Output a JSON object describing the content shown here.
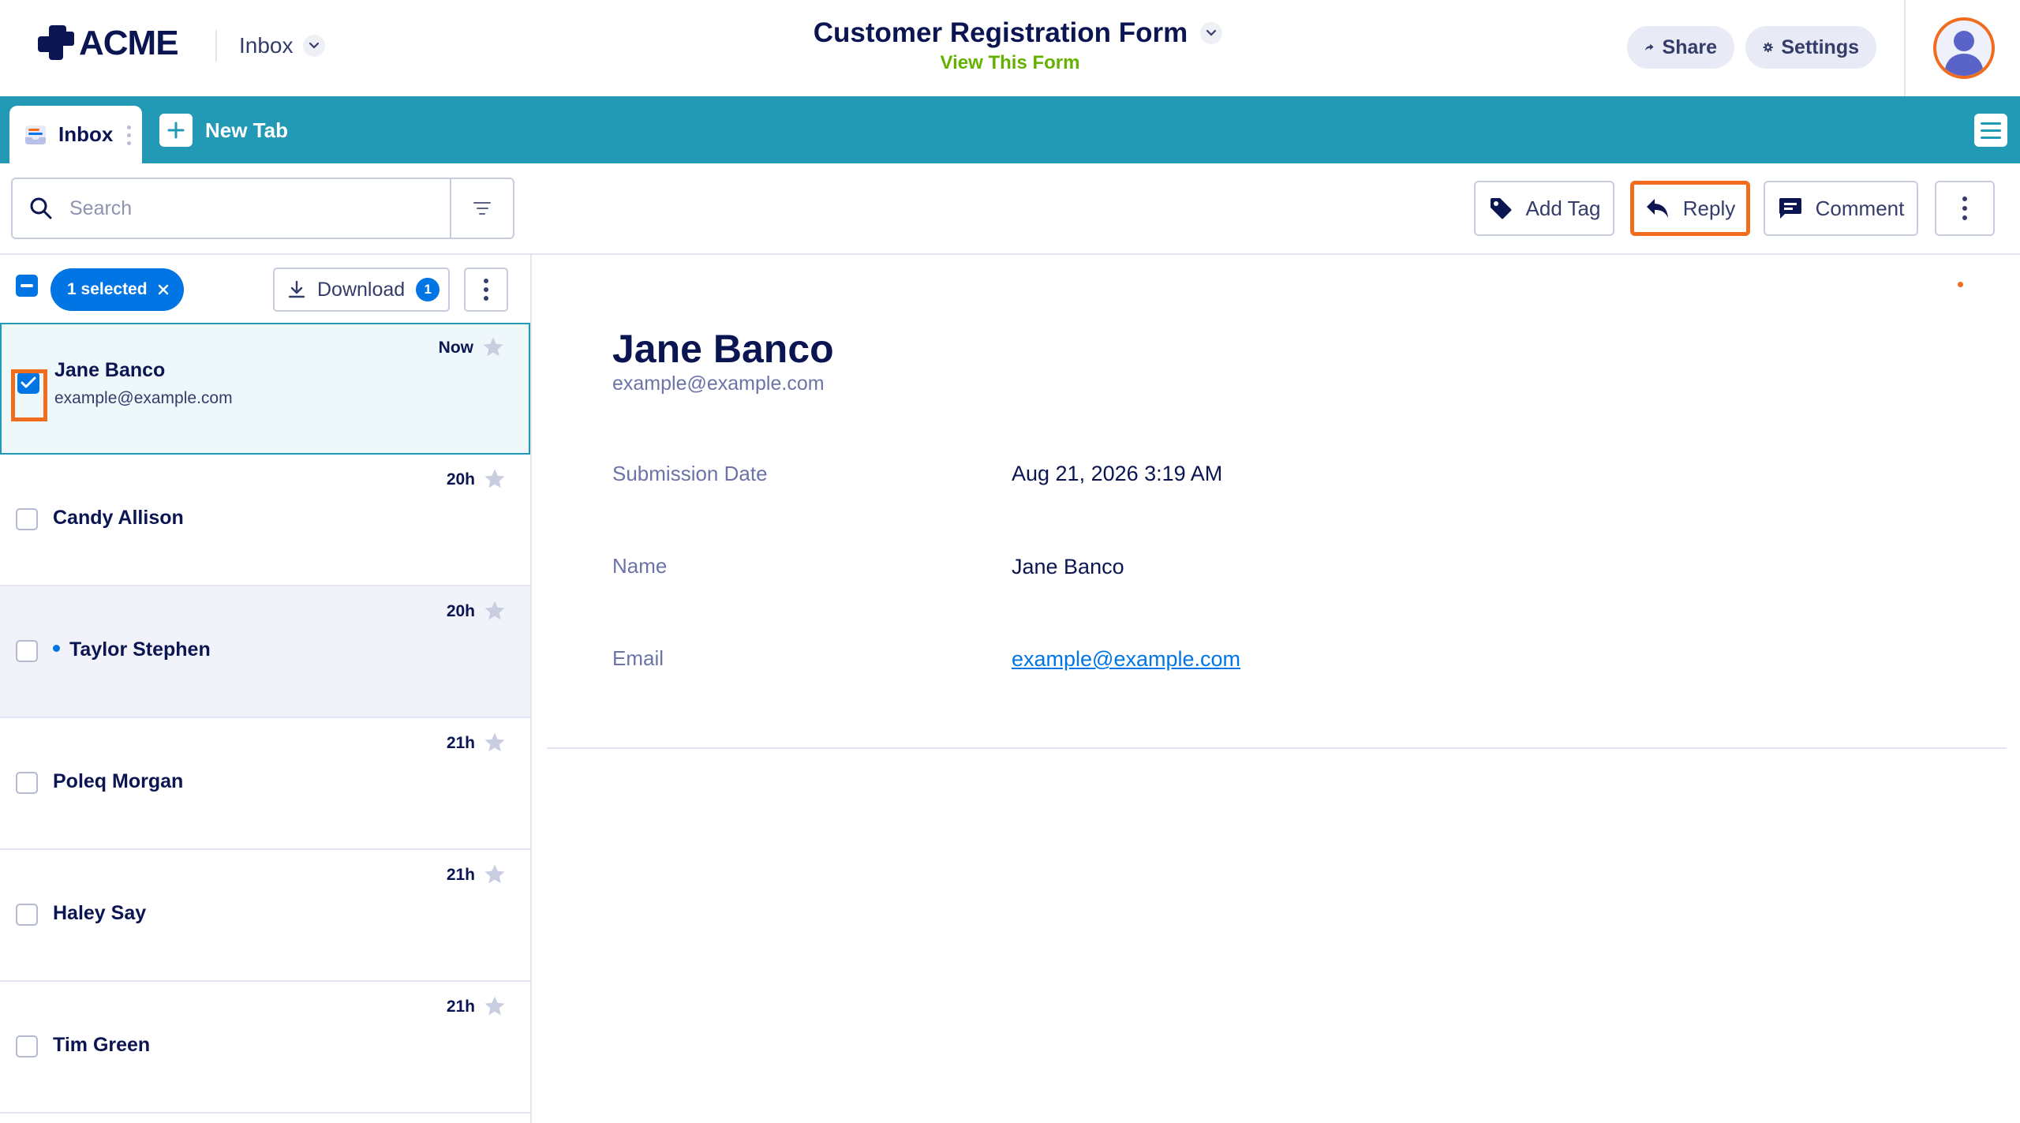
{
  "header": {
    "logo_text": "ACME",
    "inbox_switch_label": "Inbox",
    "form_title": "Customer Registration Form",
    "view_form_link": "View This Form",
    "share_label": "Share",
    "settings_label": "Settings"
  },
  "tabs": {
    "active_tab_label": "Inbox",
    "new_tab_label": "New Tab"
  },
  "toolbar": {
    "search_placeholder": "Search",
    "add_tag_label": "Add Tag",
    "reply_label": "Reply",
    "comment_label": "Comment"
  },
  "list_actions": {
    "selected_label": "1 selected",
    "download_label": "Download",
    "download_count": "1"
  },
  "submissions": [
    {
      "name": "Jane Banco",
      "email": "example@example.com",
      "time": "Now",
      "checked": true,
      "unread": false
    },
    {
      "name": "Candy Allison",
      "email": "",
      "time": "20h",
      "checked": false,
      "unread": false
    },
    {
      "name": "Taylor Stephen",
      "email": "",
      "time": "20h",
      "checked": false,
      "unread": true
    },
    {
      "name": "Poleq Morgan",
      "email": "",
      "time": "21h",
      "checked": false,
      "unread": false
    },
    {
      "name": "Haley Say",
      "email": "",
      "time": "21h",
      "checked": false,
      "unread": false
    },
    {
      "name": "Tim Green",
      "email": "",
      "time": "21h",
      "checked": false,
      "unread": false
    }
  ],
  "detail": {
    "name": "Jane Banco",
    "email": "example@example.com",
    "fields": [
      {
        "label": "Submission Date",
        "value": "Aug 21, 2026 3:19 AM"
      },
      {
        "label": "Name",
        "value": "Jane Banco"
      },
      {
        "label": "Email",
        "value": "example@example.com"
      }
    ]
  },
  "colors": {
    "brand_navy": "#0a1551",
    "tabbar_teal": "#2299b5",
    "accent_blue": "#0075e3",
    "highlight_orange": "#f06c1e",
    "view_form_green": "#64b200"
  }
}
